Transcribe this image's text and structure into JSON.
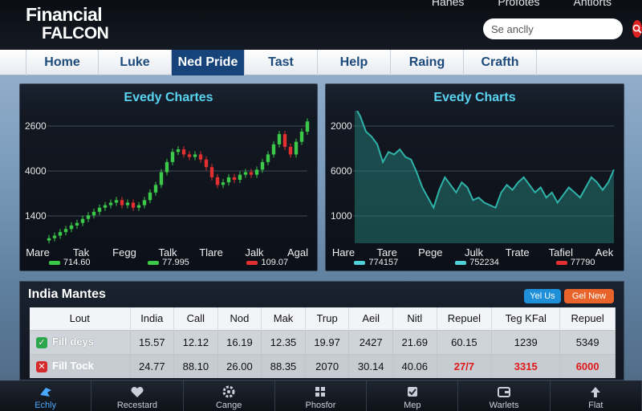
{
  "app": {
    "logo_line1": "Financial",
    "logo_line2": "FALCON"
  },
  "top_links": [
    "Hanes",
    "Profotes",
    "Antiorts"
  ],
  "search": {
    "placeholder": "Se anclly",
    "icon": "search-icon"
  },
  "nav": {
    "tabs": [
      "Home",
      "Luke",
      "Ned Pride",
      "Tast",
      "Help",
      "Raing",
      "Crafth"
    ],
    "active_index": 2
  },
  "colors": {
    "accent": "#16447a",
    "up": "#3cc94a",
    "down": "#e23030",
    "teal": "#2f8f86",
    "title": "#59d4f0"
  },
  "chart_data": [
    {
      "type": "candlestick",
      "title": "Evedy Chartes",
      "y_ticks": [
        "2600",
        "4000",
        "1400"
      ],
      "x_ticks": [
        "Mare",
        "Tak",
        "Fegg",
        "Talk",
        "Tlare",
        "Jalk",
        "Agal"
      ],
      "legend": [
        {
          "label": "714.60",
          "color": "#3cc94a"
        },
        {
          "label": "77.995",
          "color": "#3cc94a"
        },
        {
          "label": "109.07",
          "color": "#e23030"
        }
      ],
      "series": [
        {
          "name": "",
          "values": [
            1300,
            1350,
            1420,
            1480,
            1550,
            1600,
            1680,
            1750,
            1820,
            1900,
            1950,
            2000,
            2050,
            1950,
            2000,
            1900,
            1950,
            2050,
            2200,
            2350,
            2600,
            2800,
            3000,
            3050,
            2950,
            2900,
            2950,
            2850,
            2700,
            2500,
            2350,
            2400,
            2500,
            2450,
            2550,
            2600,
            2550,
            2650,
            2800,
            2950,
            3150,
            3350,
            3100,
            2950,
            3200,
            3400,
            3600
          ]
        }
      ]
    },
    {
      "type": "area",
      "title": "Evedy Charts",
      "y_ticks": [
        "2000",
        "6000",
        "1000"
      ],
      "x_ticks": [
        "Hare",
        "Tare",
        "Pege",
        "Julk",
        "Trate",
        "Tafiel",
        "Aek"
      ],
      "legend": [
        {
          "label": "774157",
          "color": "#4fd0d8"
        },
        {
          "label": "752234",
          "color": "#4fd0d8"
        },
        {
          "label": "77790",
          "color": "#e23030"
        }
      ],
      "series": [
        {
          "name": "",
          "values": [
            3900,
            3700,
            3400,
            3300,
            3150,
            2800,
            3000,
            2950,
            3050,
            2900,
            2850,
            2600,
            2300,
            2100,
            1900,
            2250,
            2500,
            2350,
            2200,
            2400,
            2300,
            2050,
            2100,
            2000,
            1950,
            1900,
            2200,
            2350,
            2250,
            2400,
            2500,
            2350,
            2200,
            2300,
            2100,
            2200,
            2000,
            2150,
            2300,
            2200,
            2100,
            2300,
            2500,
            2400,
            2250,
            2400,
            2650
          ]
        }
      ]
    }
  ],
  "market": {
    "title": "India Mantes",
    "btn1": "Yel Us",
    "btn2": "Gel New",
    "headers": [
      "Lout",
      "India",
      "Call",
      "Nod",
      "Mak",
      "Trup",
      "Aeil",
      "Nitl",
      "Repuel",
      "Teg KFal",
      "Repuel"
    ],
    "rows": [
      {
        "name": "Fill deys",
        "status": "check",
        "cells": [
          "15.57",
          "12.12",
          "16.19",
          "12.35",
          "19.97",
          "2427",
          "21.69",
          "60.15",
          "1239",
          "5349"
        ],
        "red": []
      },
      {
        "name": "Fill Tock",
        "status": "x",
        "cells": [
          "24.77",
          "88.10",
          "26.00",
          "88.35",
          "2070",
          "30.14",
          "40.06",
          "27/7",
          "3315",
          "6000"
        ],
        "red": [
          7,
          8,
          9
        ]
      }
    ]
  },
  "bottom_bar": [
    {
      "label": "Echly",
      "icon": "bird-icon"
    },
    {
      "label": "Recestard",
      "icon": "heart-icon"
    },
    {
      "label": "Cange",
      "icon": "gear-icon"
    },
    {
      "label": "Phosfor",
      "icon": "grid-icon"
    },
    {
      "label": "Mep",
      "icon": "check-box-icon"
    },
    {
      "label": "Warlets",
      "icon": "wallet-icon"
    },
    {
      "label": "Flat",
      "icon": "upload-icon"
    }
  ]
}
